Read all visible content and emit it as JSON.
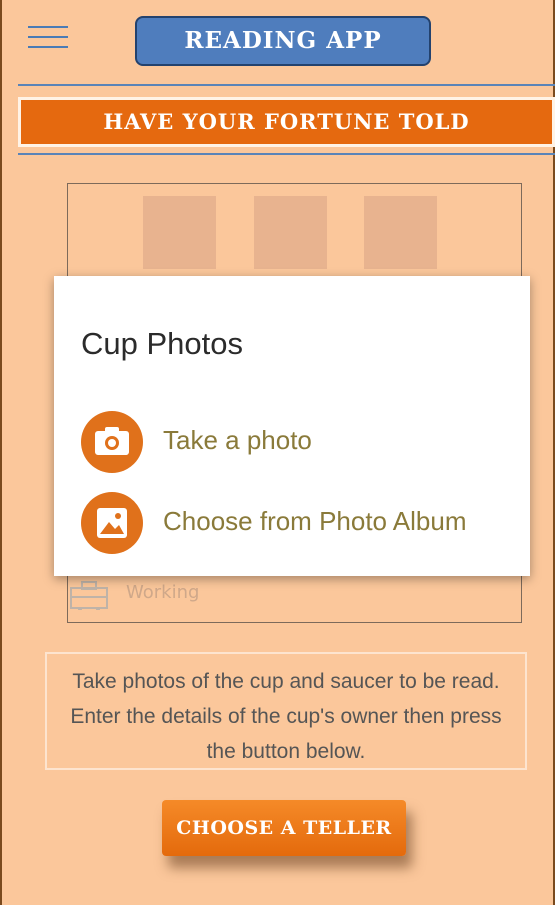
{
  "header": {
    "menu_icon": "hamburger-menu-icon",
    "title": "Reading App"
  },
  "banner": {
    "text": "Have your fortune told"
  },
  "photo_panel": {
    "working_icon": "briefcase-icon",
    "working_label": "Working"
  },
  "dialog": {
    "title": "Cup Photos",
    "options": [
      {
        "icon": "camera-icon",
        "label": "Take a photo"
      },
      {
        "icon": "image-icon",
        "label": "Choose from Photo Album"
      }
    ]
  },
  "info": {
    "text": "Take photos of the cup and saucer to be read. Enter the details of the cup's owner then press the button below."
  },
  "cta": {
    "label": "Choose a teller"
  },
  "colors": {
    "background": "#fbc79b",
    "accent": "#e5690f",
    "title_blue": "#4f7dbd"
  }
}
